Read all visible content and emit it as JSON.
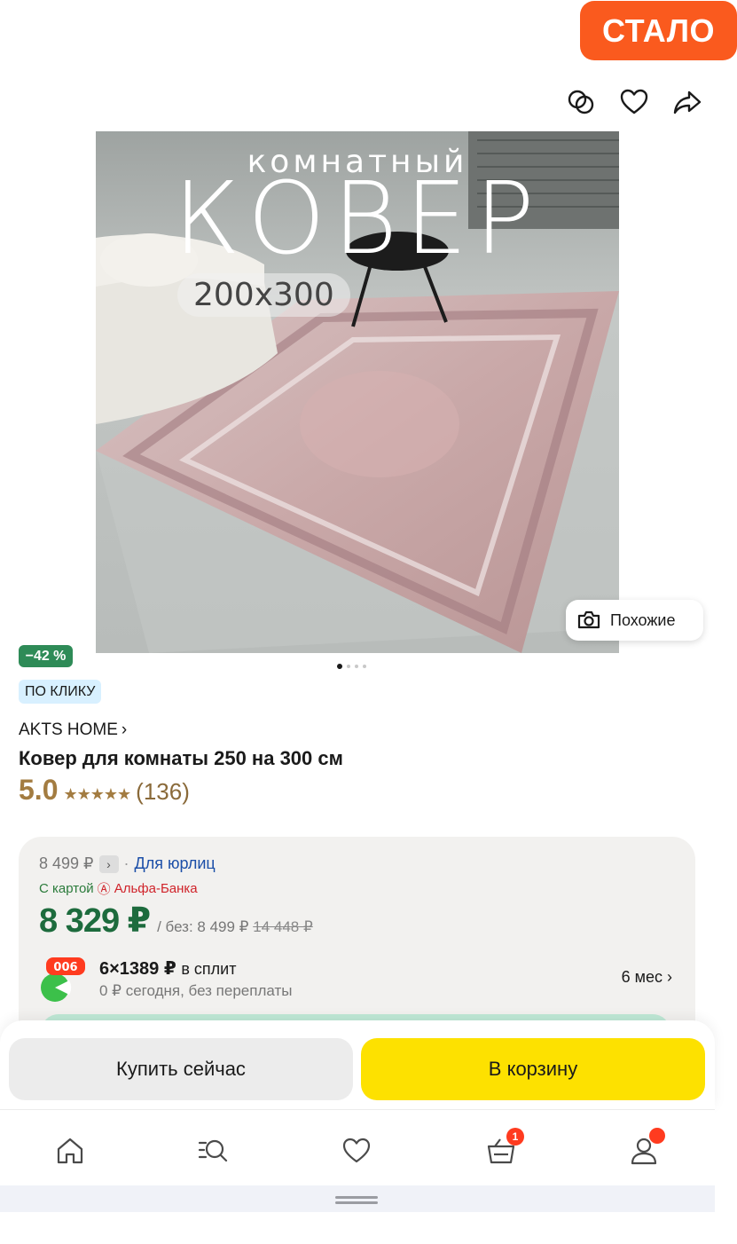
{
  "corner_badge": "СТАЛО",
  "top_icons": [
    "compare-icon",
    "heart-icon",
    "share-icon"
  ],
  "hero": {
    "line1": "комнатный",
    "line2": "КОВЕР",
    "size": "200x300"
  },
  "similar_button": "Похожие",
  "discount": "−42 %",
  "click_badge": "ПО КЛИКУ",
  "brand": "AKTS HOME",
  "title": "Ковер для комнаты 250 на 300 см",
  "rating": {
    "value": "5.0",
    "stars": "★★★★★",
    "count": "(136)"
  },
  "price_card": {
    "old_price": "8 499 ₽",
    "legal_link": "Для юрлиц",
    "card_text": "С картой",
    "bank_name": "Альфа-Банка",
    "main_price": "8 329 ₽",
    "without_label": "/ без: 8 499 ₽",
    "crossed_price": "14 448 ₽",
    "split": {
      "badge": "006",
      "main": "6×1389 ₽",
      "main_suffix": "в сплит",
      "sub": "0 ₽ сегодня, без переплаты",
      "months": "6 мес"
    }
  },
  "actions": {
    "buy_now": "Купить сейчас",
    "add_to_cart": "В корзину"
  },
  "tabbar": {
    "items": [
      "home-icon",
      "catalog-search-icon",
      "favorites-icon",
      "cart-icon",
      "profile-icon"
    ],
    "cart_count": "1"
  },
  "colors": {
    "accent_orange": "#fa5a1e",
    "price_green": "#1d6b3d",
    "cart_yellow": "#fde100",
    "rating_gold": "#a37c41"
  },
  "gallery": {
    "slides": 4,
    "active_slide": 1
  }
}
